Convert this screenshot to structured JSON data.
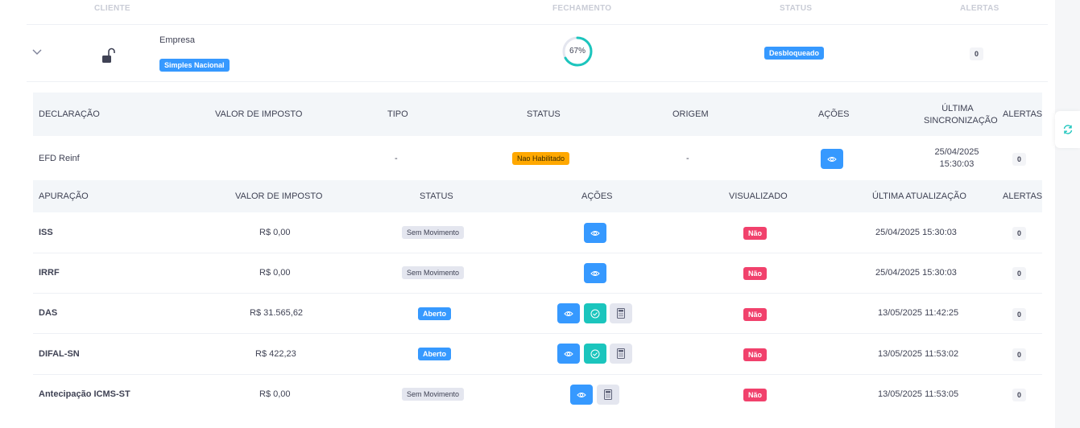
{
  "header": {
    "cliente": "CLIENTE",
    "fechamento": "FECHAMENTO",
    "status": "STATUS",
    "alertas": "ALERTAS"
  },
  "client": {
    "name": "Empresa",
    "regime": "Simples Nacional",
    "fechamento_pct": 67,
    "fechamento_label": "67%",
    "status": "Desbloqueado",
    "alertas": "0"
  },
  "declaracoes": {
    "headers": {
      "declaracao": "DECLARAÇÃO",
      "valor": "VALOR DE IMPOSTO",
      "tipo": "TIPO",
      "status": "STATUS",
      "origem": "ORIGEM",
      "acoes": "AÇÕES",
      "ultima_sync_1": "ÚLTIMA",
      "ultima_sync_2": "SINCRONIZAÇÃO",
      "alertas": "ALERTAS"
    },
    "rows": [
      {
        "declaracao": "EFD Reinf",
        "valor": "",
        "tipo": "-",
        "status": "Nao Habilitado",
        "origem": "-",
        "data": "25/04/2025",
        "hora": "15:30:03",
        "alertas": "0"
      }
    ]
  },
  "apuracoes": {
    "headers": {
      "apuracao": "APURAÇÃO",
      "valor": "VALOR DE IMPOSTO",
      "status": "STATUS",
      "acoes": "AÇÕES",
      "visualizado": "VISUALIZADO",
      "ultima": "ÚLTIMA ATUALIZAÇÃO",
      "alertas": "ALERTAS"
    },
    "rows": [
      {
        "apuracao": "ISS",
        "valor": "R$ 0,00",
        "status": "Sem Movimento",
        "visualizado": "Não",
        "ultima": "25/04/2025 15:30:03",
        "alertas": "0"
      },
      {
        "apuracao": "IRRF",
        "valor": "R$ 0,00",
        "status": "Sem Movimento",
        "visualizado": "Não",
        "ultima": "25/04/2025 15:30:03",
        "alertas": "0"
      },
      {
        "apuracao": "DAS",
        "valor": "R$ 31.565,62",
        "status": "Aberto",
        "visualizado": "Não",
        "ultima": "13/05/2025 11:42:25",
        "alertas": "0"
      },
      {
        "apuracao": "DIFAL-SN",
        "valor": "R$ 422,23",
        "status": "Aberto",
        "visualizado": "Não",
        "ultima": "13/05/2025 11:53:02",
        "alertas": "0"
      },
      {
        "apuracao": "Antecipação ICMS-ST",
        "valor": "R$ 0,00",
        "status": "Sem Movimento",
        "visualizado": "Não",
        "ultima": "13/05/2025 11:53:05",
        "alertas": "0"
      }
    ]
  },
  "icons": {
    "expand": "chevron-down-icon",
    "lock": "unlocked-padlock-icon",
    "view": "eye-icon",
    "confirm": "check-circle-icon",
    "calc": "calculator-icon",
    "refresh": "refresh-icon"
  },
  "colors": {
    "primary": "#3699ff",
    "teal": "#1bc5bd",
    "danger": "#f1416c",
    "warning": "#ffa800"
  }
}
